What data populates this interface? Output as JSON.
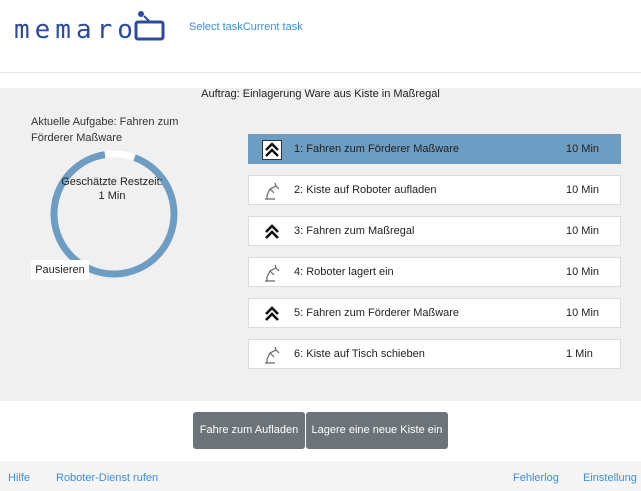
{
  "header": {
    "logo_text": "memaro",
    "nav": [
      "Select task",
      "Current task"
    ]
  },
  "order": {
    "title": "Auftrag: Einlagerung Ware aus Kiste in Maßregal"
  },
  "current": {
    "label": "Aktuelle Aufgabe: Fahren zum Förderer Maßware",
    "remaining_label": "Geschätzte Restzeit:",
    "remaining_value": "1 Min",
    "progress_fraction": 0.92,
    "pause_label": "Pausieren"
  },
  "tasks": [
    {
      "label": "1: Fahren zum Förderer Maßware",
      "duration": "10 Min",
      "icon": "chevron-up-icon",
      "active": true
    },
    {
      "label": "2: Kiste auf Roboter aufladen",
      "duration": "10 Min",
      "icon": "robot-arm-icon",
      "active": false
    },
    {
      "label": "3: Fahren zum Maßregal",
      "duration": "10 Min",
      "icon": "chevron-up-icon",
      "active": false
    },
    {
      "label": "4: Roboter lagert ein",
      "duration": "10 Min",
      "icon": "robot-arm-icon",
      "active": false
    },
    {
      "label": "5: Fahren zum Förderer Maßware",
      "duration": "10 Min",
      "icon": "chevron-up-icon",
      "active": false
    },
    {
      "label": "6: Kiste auf Tisch schieben",
      "duration": "1 Min",
      "icon": "robot-arm-icon",
      "active": false
    }
  ],
  "actions": {
    "charge_label": "Fahre zum Aufladen",
    "store_label": "Lagere eine neue Kiste ein"
  },
  "footer": {
    "help": "Hilfe",
    "call_service": "Roboter-Dienst rufen",
    "error_log": "Fehlerlog",
    "settings": "Einstellung"
  },
  "colors": {
    "accent": "#6d9dc2",
    "link": "#3b8ed8",
    "button": "#6c7479",
    "logo": "#2c4a9e"
  }
}
